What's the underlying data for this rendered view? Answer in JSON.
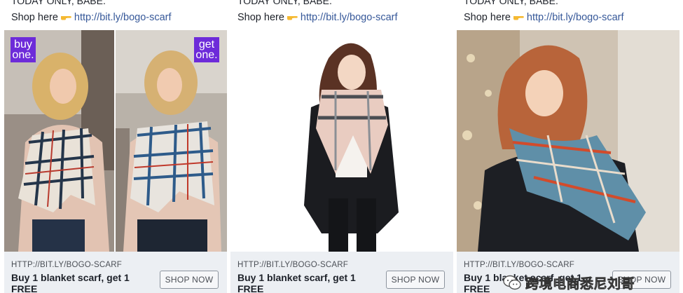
{
  "ads": [
    {
      "intro_text": "TODAY ONLY, BABE.",
      "shop_prefix": "Shop here",
      "link": "http://bit.ly/bogo-scarf",
      "badges": [
        "buy one.",
        "get one."
      ],
      "domain": "HTTP://BIT.LY/BOGO-SCARF",
      "headline": "Buy 1 blanket scarf, get 1 FREE",
      "cta": "SHOP NOW"
    },
    {
      "intro_text": "TODAY ONLY, BABE.",
      "shop_prefix": "Shop here",
      "link": "http://bit.ly/bogo-scarf",
      "domain": "HTTP://BIT.LY/BOGO-SCARF",
      "headline": "Buy 1 blanket scarf, get 1 FREE",
      "cta": "SHOP NOW"
    },
    {
      "intro_text": "TODAY ONLY, BABE.",
      "shop_prefix": "Shop here",
      "link": "http://bit.ly/bogo-scarf",
      "domain": "HTTP://BIT.LY/BOGO-SCARF",
      "headline": "Buy 1 blanket scarf, get 1 FREE",
      "cta": "SHOP NOW"
    }
  ],
  "watermark": "跨境电商悉尼刘哥",
  "colors": {
    "link": "#365899",
    "badge": "#6d2bd9",
    "footer_bg": "#eceff3"
  },
  "icons": [
    "pointing-hand-icon",
    "wechat-icon"
  ]
}
